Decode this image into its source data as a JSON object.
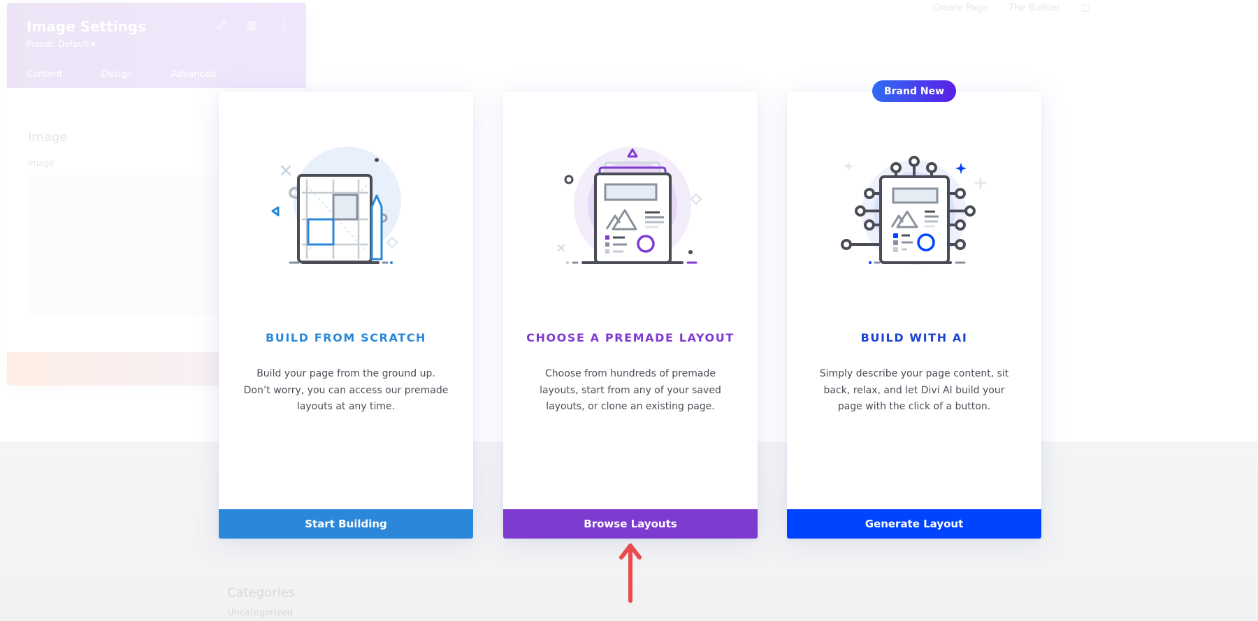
{
  "background": {
    "settings_panel": {
      "title": "Image Settings",
      "preset": "Preset: Default ▾",
      "tabs": [
        "Content",
        "Design",
        "Advanced"
      ],
      "section_title": "Image",
      "field_label": "Image",
      "icons": [
        "expand-icon",
        "columns-icon",
        "more-icon"
      ]
    },
    "top_nav": [
      "Create Page",
      "The Builder",
      "□"
    ],
    "footer": {
      "title": "Categories",
      "item": "Uncategorized"
    }
  },
  "cards": [
    {
      "id": "build-from-scratch",
      "title": "BUILD FROM SCRATCH",
      "description": "Build your page from the ground up. Don’t worry, you can access our premade layouts at any time.",
      "button_label": "Start Building",
      "accent": "#2b87da",
      "illustration": "blueprint-grid-icon"
    },
    {
      "id": "choose-premade-layout",
      "title": "CHOOSE A PREMADE LAYOUT",
      "description": "Choose from hundreds of premade layouts, start from any of your saved layouts, or clone an existing page.",
      "button_label": "Browse Layouts",
      "accent": "#7e3bd0",
      "illustration": "layout-document-icon"
    },
    {
      "id": "build-with-ai",
      "badge": "Brand New",
      "title": "BUILD WITH AI",
      "description": "Simply describe your page content, sit back, relax, and let Divi AI build your page with the click of a button.",
      "button_label": "Generate Layout",
      "accent": "#0044ff",
      "illustration": "ai-circuit-document-icon"
    }
  ],
  "annotation": {
    "arrow_color": "#e84c4c",
    "arrow_target": "Browse Layouts"
  }
}
